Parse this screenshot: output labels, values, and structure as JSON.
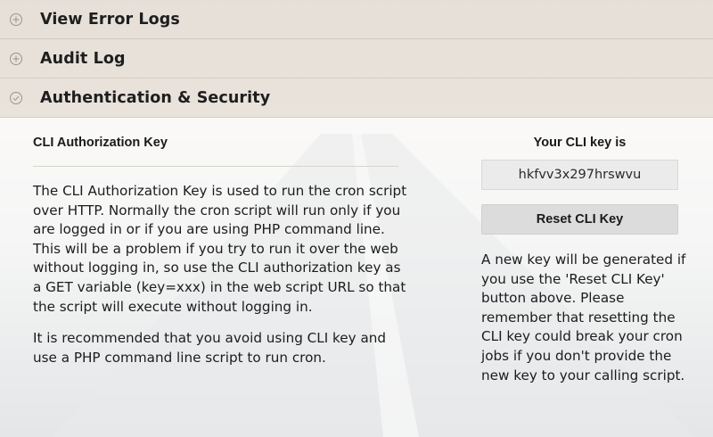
{
  "accordion": {
    "items": [
      {
        "label": "View Error Logs",
        "icon": "plus-circle-icon",
        "expanded": false
      },
      {
        "label": "Audit Log",
        "icon": "plus-circle-icon",
        "expanded": false
      },
      {
        "label": "Authentication & Security",
        "icon": "check-circle-icon",
        "expanded": true
      }
    ]
  },
  "cli": {
    "section_title": "CLI Authorization Key",
    "description_p1": "The CLI Authorization Key is used to run the cron script over HTTP. Normally the cron script will run only if you are logged in or if you are using PHP command line. This will be a problem if you try to run it over the web without logging in, so use the CLI authorization key as a GET variable (key=xxx) in the web script URL so that the script will execute without logging in.",
    "description_p2": "It is recommended that you avoid using CLI key and use a PHP command line script to run cron.",
    "key_label": "Your CLI key is",
    "key_value": "hkfvv3x297hrswvu",
    "reset_button_label": "Reset CLI Key",
    "reset_note": "A new key will be generated if you use the 'Reset CLI Key' button above. Please remember that resetting the CLI key could break your cron jobs if you don't provide the new key to your calling script."
  },
  "colors": {
    "header_bg": "#ece5de",
    "key_box_bg": "#ebebeb",
    "button_bg": "#dcdcdc",
    "text": "#1c1c1c"
  }
}
